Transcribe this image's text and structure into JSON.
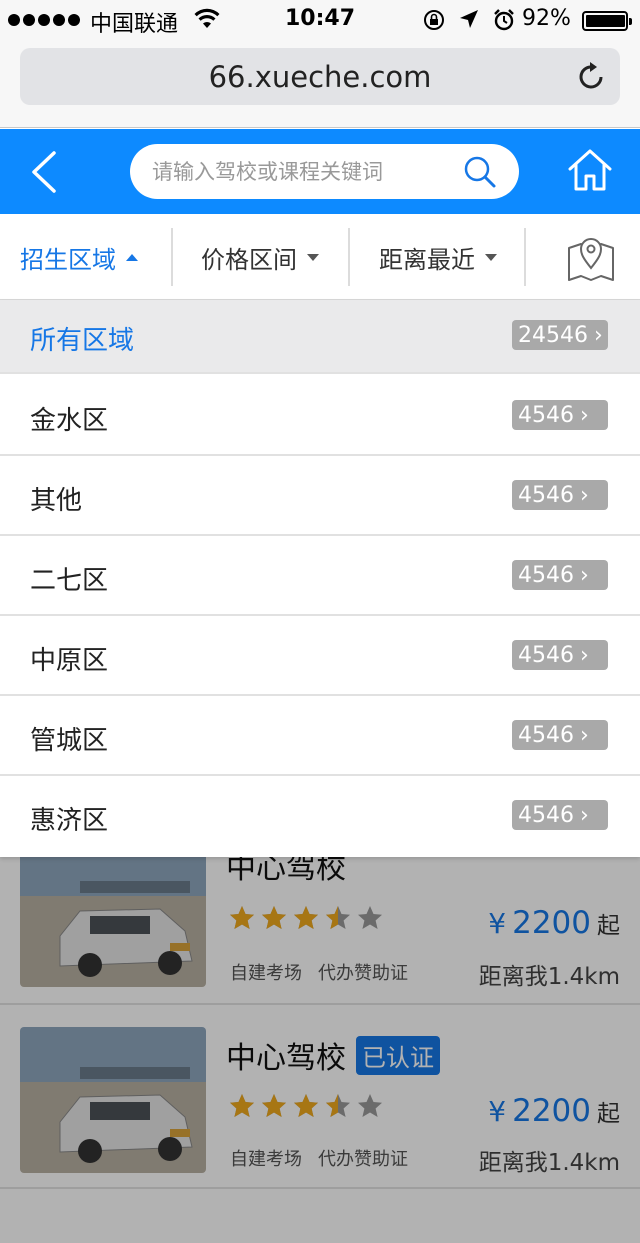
{
  "status_bar": {
    "carrier": "中国联通",
    "time": "10:47",
    "battery_percent": "92%",
    "battery_level": 0.92
  },
  "browser": {
    "url": "66.xueche.com",
    "reload_icon": "reload-icon"
  },
  "header": {
    "back_icon": "chevron-left-icon",
    "search_placeholder": "请输入驾校或课程关键词",
    "search_icon": "search-icon",
    "home_icon": "home-icon",
    "bg_color": "#0d8aff"
  },
  "filters": {
    "tabs": [
      {
        "label": "招生区域",
        "active": true
      },
      {
        "label": "价格区间",
        "active": false
      },
      {
        "label": "距离最近",
        "active": false
      }
    ],
    "map_icon": "map-pin-icon",
    "accent_color": "#1677e6"
  },
  "regions": [
    {
      "label": "所有区域",
      "count": "24546"
    },
    {
      "label": "金水区",
      "count": "4546"
    },
    {
      "label": "其他",
      "count": "4546"
    },
    {
      "label": "二七区",
      "count": "4546"
    },
    {
      "label": "中原区",
      "count": "4546"
    },
    {
      "label": "管城区",
      "count": "4546"
    },
    {
      "label": "惠济区",
      "count": "4546"
    }
  ],
  "schools": [
    {
      "name": "中心驾校",
      "verified": "",
      "rating": 3.5,
      "tags": [
        "自建考场",
        "代办赞助证"
      ],
      "currency": "¥",
      "price": "2200",
      "price_suffix": "起",
      "distance": "距离我1.4km"
    },
    {
      "name": "中心驾校",
      "verified": "已认证",
      "rating": 3.5,
      "tags": [
        "自建考场",
        "代办赞助证"
      ],
      "currency": "¥",
      "price": "2200",
      "price_suffix": "起",
      "distance": "距离我1.4km"
    }
  ]
}
